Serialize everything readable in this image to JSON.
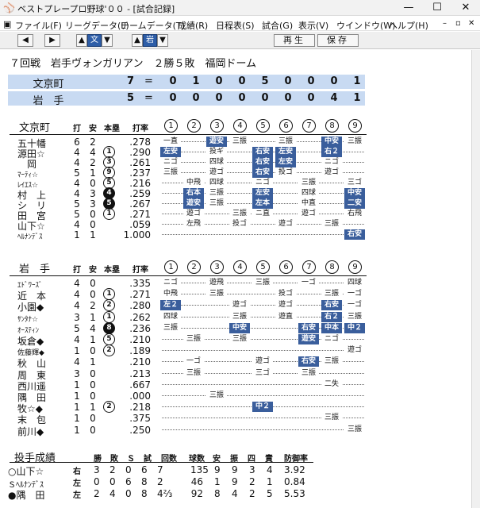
{
  "window": {
    "title": "ベストプレープロ野球'００ - [試合記録]",
    "app_icon": "baseball-app-icon",
    "controls": [
      "—",
      "☐",
      "✕"
    ]
  },
  "menu": [
    "ファイル(F)",
    "リーグデータ(L)",
    "チームデータ(T)",
    "成績(R)",
    "日程表(S)",
    "試合(G)",
    "表示(V)",
    "ウインドウ(W)",
    "ヘルプ(H)"
  ],
  "toolbar": {
    "play": "再生",
    "save": "保存",
    "team_a": "文",
    "team_b": "岩"
  },
  "game": {
    "title": "７回戦　岩手ヴォンガリアン　２勝５敗　福岡ドーム",
    "home": {
      "name": "文京町",
      "total": "7",
      "innings": [
        "0",
        "1",
        "0",
        "0",
        "5",
        "0",
        "0",
        "0",
        "1"
      ]
    },
    "away": {
      "name": "岩　手",
      "total": "5",
      "innings": [
        "0",
        "0",
        "0",
        "0",
        "0",
        "0",
        "0",
        "4",
        "1"
      ]
    }
  },
  "headers": {
    "ab": "打",
    "h": "安",
    "hr": "本塁",
    "avg": "打率",
    "inn": [
      "1",
      "2",
      "3",
      "4",
      "5",
      "6",
      "7",
      "8",
      "9"
    ]
  },
  "team1": {
    "name": "文京町",
    "players": [
      {
        "name": "五十幡",
        "ab": "6",
        "h": "2",
        "hr": "",
        "avg": ".278",
        "res": [
          [
            "一直",
            0
          ],
          [
            "",
            0
          ],
          [
            "遊安",
            1
          ],
          [
            "三振",
            0
          ],
          [
            "",
            0
          ],
          [
            "三振",
            0
          ],
          [
            "",
            0
          ],
          [
            "中安",
            1
          ],
          [
            "三振",
            0
          ]
        ]
      },
      {
        "name": "源田☆",
        "ab": "4",
        "h": "4",
        "hr": "1",
        "avg": ".290",
        "res": [
          [
            "左安",
            1
          ],
          [
            "",
            0
          ],
          [
            "投ギ",
            0
          ],
          [
            "",
            0
          ],
          [
            "右安",
            1
          ],
          [
            "左安",
            1
          ],
          [
            "",
            0
          ],
          [
            "右２",
            1
          ],
          [
            "",
            0
          ]
        ]
      },
      {
        "name": "　岡",
        "ab": "4",
        "h": "2",
        "hr": "3",
        "avg": ".261",
        "res": [
          [
            "ニゴ",
            0
          ],
          [
            "",
            0
          ],
          [
            "四球",
            0
          ],
          [
            "",
            0
          ],
          [
            "右安",
            1
          ],
          [
            "左安",
            1
          ],
          [
            "",
            0
          ],
          [
            "ニゴ",
            0
          ],
          [
            "",
            0
          ]
        ]
      },
      {
        "name": "ﾏｰﾃｨ☆",
        "ab": "5",
        "h": "1",
        "hr": "9",
        "avg": ".237",
        "sm": 1,
        "res": [
          [
            "三振",
            0
          ],
          [
            "",
            0
          ],
          [
            "遊ゴ",
            0
          ],
          [
            "",
            0
          ],
          [
            "右安",
            1
          ],
          [
            "投ゴ",
            0
          ],
          [
            "",
            0
          ],
          [
            "遊ゴ",
            0
          ],
          [
            "",
            0
          ]
        ]
      },
      {
        "name": "ﾚｲｴｽ☆",
        "ab": "4",
        "h": "0",
        "hr": "5",
        "avg": ".216",
        "sm": 1,
        "res": [
          [
            "",
            0
          ],
          [
            "中飛",
            0
          ],
          [
            "四球",
            0
          ],
          [
            "",
            0
          ],
          [
            "ニゴ",
            0
          ],
          [
            "",
            0
          ],
          [
            "三振",
            0
          ],
          [
            "",
            0
          ],
          [
            "三ゴ",
            0
          ]
        ]
      },
      {
        "name": "村　上",
        "ab": "4",
        "h": "3",
        "hr": "4",
        "avg": ".259",
        "hrf": 1,
        "res": [
          [
            "",
            0
          ],
          [
            "右本",
            1
          ],
          [
            "三振",
            0
          ],
          [
            "",
            0
          ],
          [
            "左安",
            1
          ],
          [
            "",
            0
          ],
          [
            "四球",
            0
          ],
          [
            "",
            0
          ],
          [
            "中安",
            1
          ]
        ]
      },
      {
        "name": "シ　リ",
        "ab": "5",
        "h": "3",
        "hr": "5",
        "avg": ".267",
        "hrf": 1,
        "res": [
          [
            "",
            0
          ],
          [
            "遊安",
            1
          ],
          [
            "三振",
            0
          ],
          [
            "",
            0
          ],
          [
            "左本",
            1
          ],
          [
            "",
            0
          ],
          [
            "中直",
            0
          ],
          [
            "",
            0
          ],
          [
            "二安",
            1
          ]
        ]
      },
      {
        "name": "田　宮",
        "ab": "5",
        "h": "0",
        "hr": "1",
        "avg": ".271",
        "res": [
          [
            "",
            0
          ],
          [
            "遊ゴ",
            0
          ],
          [
            "",
            0
          ],
          [
            "三振",
            0
          ],
          [
            "ニ直",
            0
          ],
          [
            "",
            0
          ],
          [
            "遊ゴ",
            0
          ],
          [
            "",
            0
          ],
          [
            "右飛",
            0
          ]
        ]
      },
      {
        "name": "山下☆",
        "ab": "4",
        "h": "0",
        "hr": "",
        "avg": ".059",
        "res": [
          [
            "",
            0
          ],
          [
            "左飛",
            0
          ],
          [
            "",
            0
          ],
          [
            "投ゴ",
            0
          ],
          [
            "",
            0
          ],
          [
            "遊ゴ",
            0
          ],
          [
            "",
            0
          ],
          [
            "三振",
            0
          ],
          [
            "",
            0
          ]
        ]
      },
      {
        "name": "ﾍﾙﾅﾝﾃﾞｽ",
        "ab": "1",
        "h": "1",
        "hr": "",
        "avg": "1.000",
        "sm": 1,
        "res": [
          [
            "",
            0
          ],
          [
            "",
            0
          ],
          [
            "",
            0
          ],
          [
            "",
            0
          ],
          [
            "",
            0
          ],
          [
            "",
            0
          ],
          [
            "",
            0
          ],
          [
            "",
            0
          ],
          [
            "右安",
            1
          ]
        ]
      }
    ]
  },
  "team2": {
    "name": "岩　手",
    "players": [
      {
        "name": "ｴﾄﾞﾜｰｽﾞ",
        "ab": "4",
        "h": "0",
        "hr": "",
        "avg": ".335",
        "sm": 1,
        "res": [
          [
            "ニゴ",
            0
          ],
          [
            "",
            0
          ],
          [
            "遊飛",
            0
          ],
          [
            "",
            0
          ],
          [
            "三振",
            0
          ],
          [
            "",
            0
          ],
          [
            "一ゴ",
            0
          ],
          [
            "",
            0
          ],
          [
            "四球",
            0
          ]
        ]
      },
      {
        "name": "近　本",
        "ab": "4",
        "h": "0",
        "hr": "1",
        "avg": ".271",
        "res": [
          [
            "中飛",
            0
          ],
          [
            "",
            0
          ],
          [
            "三振",
            0
          ],
          [
            "",
            0
          ],
          [
            "",
            0
          ],
          [
            "投ゴ",
            0
          ],
          [
            "",
            0
          ],
          [
            "三振",
            0
          ],
          [
            "一ゴ",
            0
          ]
        ]
      },
      {
        "name": "小園◆",
        "ab": "4",
        "h": "2",
        "hr": "2",
        "avg": ".280",
        "res": [
          [
            "左２",
            1
          ],
          [
            "",
            0
          ],
          [
            "",
            0
          ],
          [
            "遊ゴ",
            0
          ],
          [
            "",
            0
          ],
          [
            "遊ゴ",
            0
          ],
          [
            "",
            0
          ],
          [
            "右安",
            1
          ],
          [
            "一ゴ",
            0
          ]
        ]
      },
      {
        "name": "ｻﾝﾀﾅ☆",
        "ab": "3",
        "h": "1",
        "hr": "1",
        "avg": ".262",
        "sm": 1,
        "res": [
          [
            "四球",
            0
          ],
          [
            "",
            0
          ],
          [
            "",
            0
          ],
          [
            "三振",
            0
          ],
          [
            "",
            0
          ],
          [
            "遊直",
            0
          ],
          [
            "",
            0
          ],
          [
            "右２",
            1
          ],
          [
            "三振",
            0
          ]
        ]
      },
      {
        "name": "ｵｰｽﾃｨﾝ",
        "ab": "5",
        "h": "4",
        "hr": "8",
        "avg": ".236",
        "sm": 1,
        "hrf": 1,
        "res": [
          [
            "三振",
            0
          ],
          [
            "",
            0
          ],
          [
            "",
            0
          ],
          [
            "中安",
            1
          ],
          [
            "",
            0
          ],
          [
            "",
            0
          ],
          [
            "右安",
            1
          ],
          [
            "中本",
            1
          ],
          [
            "中２",
            1
          ]
        ]
      },
      {
        "name": "坂倉◆",
        "ab": "4",
        "h": "1",
        "hr": "5",
        "avg": ".210",
        "res": [
          [
            "",
            0
          ],
          [
            "三振",
            0
          ],
          [
            "",
            0
          ],
          [
            "三振",
            0
          ],
          [
            "",
            0
          ],
          [
            "",
            0
          ],
          [
            "遊安",
            1
          ],
          [
            "ニゴ",
            0
          ],
          [
            "",
            0
          ]
        ]
      },
      {
        "name": "佐藤輝◆",
        "ab": "1",
        "h": "0",
        "hr": "2",
        "avg": ".189",
        "sm": 1,
        "res": [
          [
            "",
            0
          ],
          [
            "",
            0
          ],
          [
            "",
            0
          ],
          [
            "",
            0
          ],
          [
            "",
            0
          ],
          [
            "",
            0
          ],
          [
            "",
            0
          ],
          [
            "",
            0
          ],
          [
            "遊ゴ",
            0
          ]
        ]
      },
      {
        "name": "秋　山",
        "ab": "4",
        "h": "1",
        "hr": "",
        "avg": ".210",
        "res": [
          [
            "",
            0
          ],
          [
            "一ゴ",
            0
          ],
          [
            "",
            0
          ],
          [
            "",
            0
          ],
          [
            "遊ゴ",
            0
          ],
          [
            "",
            0
          ],
          [
            "右安",
            1
          ],
          [
            "三振",
            0
          ],
          [
            "",
            0
          ]
        ]
      },
      {
        "name": "周　東",
        "ab": "3",
        "h": "0",
        "hr": "",
        "avg": ".213",
        "res": [
          [
            "",
            0
          ],
          [
            "三振",
            0
          ],
          [
            "",
            0
          ],
          [
            "",
            0
          ],
          [
            "三ゴ",
            0
          ],
          [
            "",
            0
          ],
          [
            "三振",
            0
          ],
          [
            "",
            0
          ],
          [
            "",
            0
          ]
        ]
      },
      {
        "name": "西川遥",
        "ab": "1",
        "h": "0",
        "hr": "",
        "avg": ".667",
        "res": [
          [
            "",
            0
          ],
          [
            "",
            0
          ],
          [
            "",
            0
          ],
          [
            "",
            0
          ],
          [
            "",
            0
          ],
          [
            "",
            0
          ],
          [
            "",
            0
          ],
          [
            "二失",
            0
          ],
          [
            "",
            0
          ]
        ]
      },
      {
        "name": "隅　田",
        "ab": "1",
        "h": "0",
        "hr": "",
        "avg": ".000",
        "res": [
          [
            "",
            0
          ],
          [
            "",
            0
          ],
          [
            "三振",
            0
          ],
          [
            "",
            0
          ],
          [
            "",
            0
          ],
          [
            "",
            0
          ],
          [
            "",
            0
          ],
          [
            "",
            0
          ],
          [
            "",
            0
          ]
        ]
      },
      {
        "name": "牧☆◆",
        "ab": "1",
        "h": "1",
        "hr": "2",
        "avg": ".218",
        "res": [
          [
            "",
            0
          ],
          [
            "",
            0
          ],
          [
            "",
            0
          ],
          [
            "",
            0
          ],
          [
            "中２",
            1
          ],
          [
            "",
            0
          ],
          [
            "",
            0
          ],
          [
            "",
            0
          ],
          [
            "",
            0
          ]
        ]
      },
      {
        "name": "末　包",
        "ab": "1",
        "h": "0",
        "hr": "",
        "avg": ".375",
        "res": [
          [
            "",
            0
          ],
          [
            "",
            0
          ],
          [
            "",
            0
          ],
          [
            "",
            0
          ],
          [
            "",
            0
          ],
          [
            "",
            0
          ],
          [
            "",
            0
          ],
          [
            "三振",
            0
          ],
          [
            "",
            0
          ]
        ]
      },
      {
        "name": "前川◆",
        "ab": "1",
        "h": "0",
        "hr": "",
        "avg": ".250",
        "res": [
          [
            "",
            0
          ],
          [
            "",
            0
          ],
          [
            "",
            0
          ],
          [
            "",
            0
          ],
          [
            "",
            0
          ],
          [
            "",
            0
          ],
          [
            "",
            0
          ],
          [
            "",
            0
          ],
          [
            "三振",
            0
          ]
        ]
      }
    ]
  },
  "pitching": {
    "title": "投手成績",
    "headers": [
      "勝",
      "敗",
      "Ｓ",
      "試",
      "回数",
      "球数",
      "安",
      "振",
      "四",
      "責",
      "防御率"
    ],
    "rows": [
      {
        "name": "○山下☆",
        "hand": "右",
        "w": "3",
        "l": "2",
        "s": "0",
        "g": "6",
        "ip": "7",
        "np": "135",
        "h": "9",
        "k": "9",
        "bb": "3",
        "er": "4",
        "era": "3.92"
      },
      {
        "name": "Ｓﾍﾙﾅﾝﾃﾞｽ",
        "hand": "左",
        "w": "0",
        "l": "0",
        "s": "6",
        "g": "8",
        "ip": "2",
        "np": "46",
        "h": "1",
        "k": "9",
        "bb": "2",
        "er": "1",
        "era": "0.84"
      },
      {
        "name": "●隅　田",
        "hand": "左",
        "w": "2",
        "l": "4",
        "s": "0",
        "g": "8",
        "ip": "4⅔",
        "np": "92",
        "h": "8",
        "k": "4",
        "bb": "2",
        "er": "5",
        "era": "5.53"
      }
    ]
  },
  "colors": {
    "score_bg": "#c8daf2",
    "hit_bg": "#3a5e9c",
    "selected": "#2e5ea8"
  }
}
